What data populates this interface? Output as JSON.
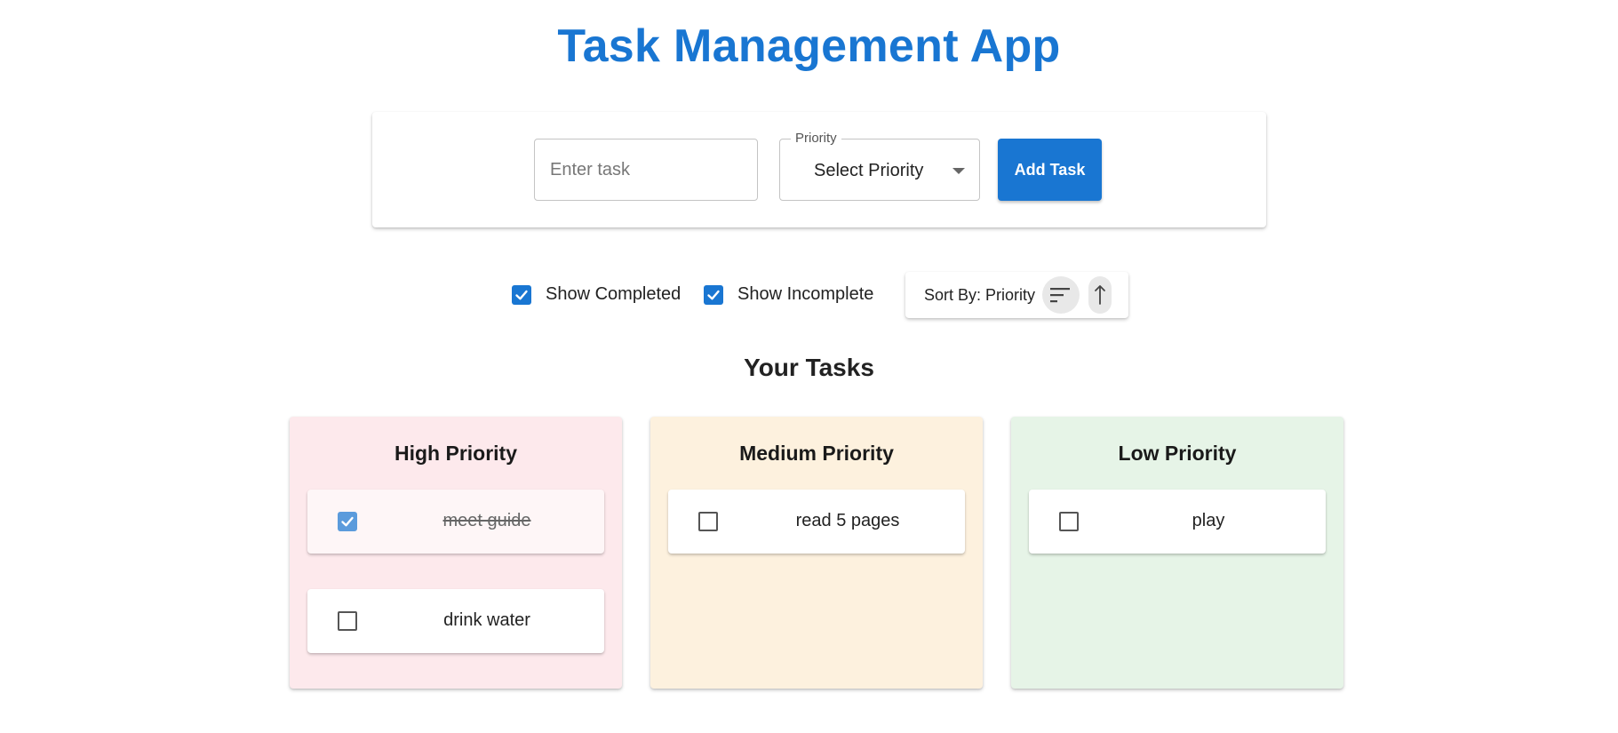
{
  "header": {
    "title": "Task Management App"
  },
  "add_form": {
    "task_placeholder": "Enter task",
    "task_value": "",
    "priority_label": "Priority",
    "priority_value": "Select Priority",
    "add_button_label": "Add Task"
  },
  "filters": {
    "show_completed": {
      "label": "Show Completed",
      "checked": true
    },
    "show_incomplete": {
      "label": "Show Incomplete",
      "checked": true
    },
    "sort": {
      "label": "Sort By: Priority",
      "direction": "ascending"
    }
  },
  "tasks_section": {
    "title": "Your Tasks"
  },
  "columns": [
    {
      "title": "High Priority",
      "color": "#fde9ec",
      "tasks": [
        {
          "text": "meet guide",
          "completed": true
        },
        {
          "text": "drink water",
          "completed": false
        }
      ]
    },
    {
      "title": "Medium Priority",
      "color": "#fdf1de",
      "tasks": [
        {
          "text": "read 5 pages",
          "completed": false
        }
      ]
    },
    {
      "title": "Low Priority",
      "color": "#e6f4e7",
      "tasks": [
        {
          "text": "play",
          "completed": false
        }
      ]
    }
  ],
  "colors": {
    "accent": "#1976d2",
    "checked_box": "#1976d2",
    "completed_box": "#5b9bdc"
  },
  "icons": {
    "sort": "sort-lines-icon",
    "direction": "arrow-up-icon",
    "dropdown": "caret-down-icon",
    "check": "check-icon"
  }
}
